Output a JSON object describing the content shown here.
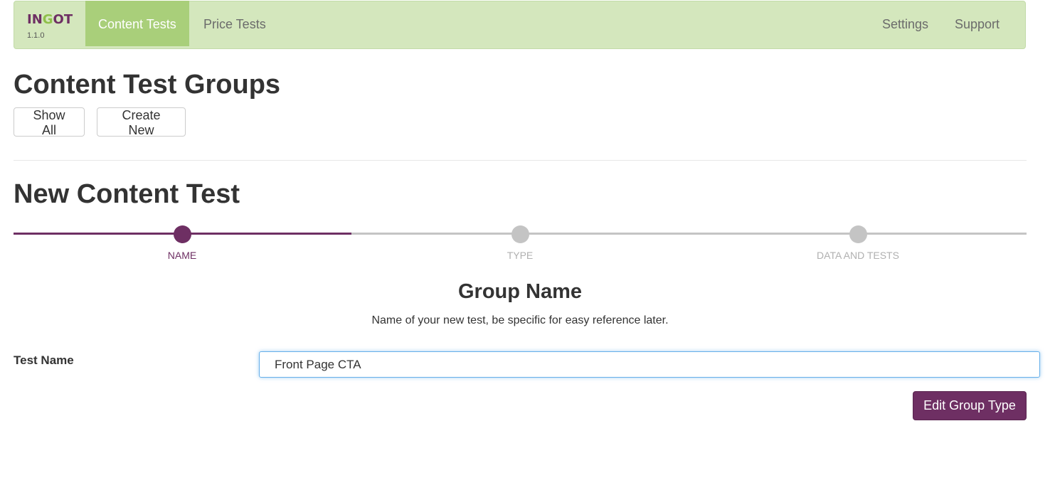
{
  "navbar": {
    "brand_logo_part1": "IN",
    "brand_logo_part2": "G",
    "brand_logo_part3": "OT",
    "version": "1.1.0",
    "items": [
      {
        "label": "Content Tests",
        "active": true
      },
      {
        "label": "Price Tests",
        "active": false
      }
    ],
    "right_items": [
      {
        "label": "Settings"
      },
      {
        "label": "Support"
      }
    ]
  },
  "groups": {
    "title": "Content Test Groups",
    "show_all_label": "Show All",
    "create_new_label": "Create New"
  },
  "wizard": {
    "title": "New Content Test",
    "progress_fraction": 0.333,
    "steps": [
      {
        "label": "NAME",
        "state": "active"
      },
      {
        "label": "TYPE",
        "state": "inactive"
      },
      {
        "label": "DATA AND TESTS",
        "state": "inactive"
      }
    ]
  },
  "form": {
    "section_title": "Group Name",
    "section_help": "Name of your new test, be specific for easy reference later.",
    "test_name_label": "Test Name",
    "test_name_value": "Front Page CTA",
    "next_button_label": "Edit Group Type"
  },
  "colors": {
    "navbar_bg": "#d4e7bd",
    "nav_active_bg": "#a9cf7a",
    "accent": "#6e2f63",
    "step_inactive": "#c4c4c4",
    "input_focus": "#66afe9"
  }
}
